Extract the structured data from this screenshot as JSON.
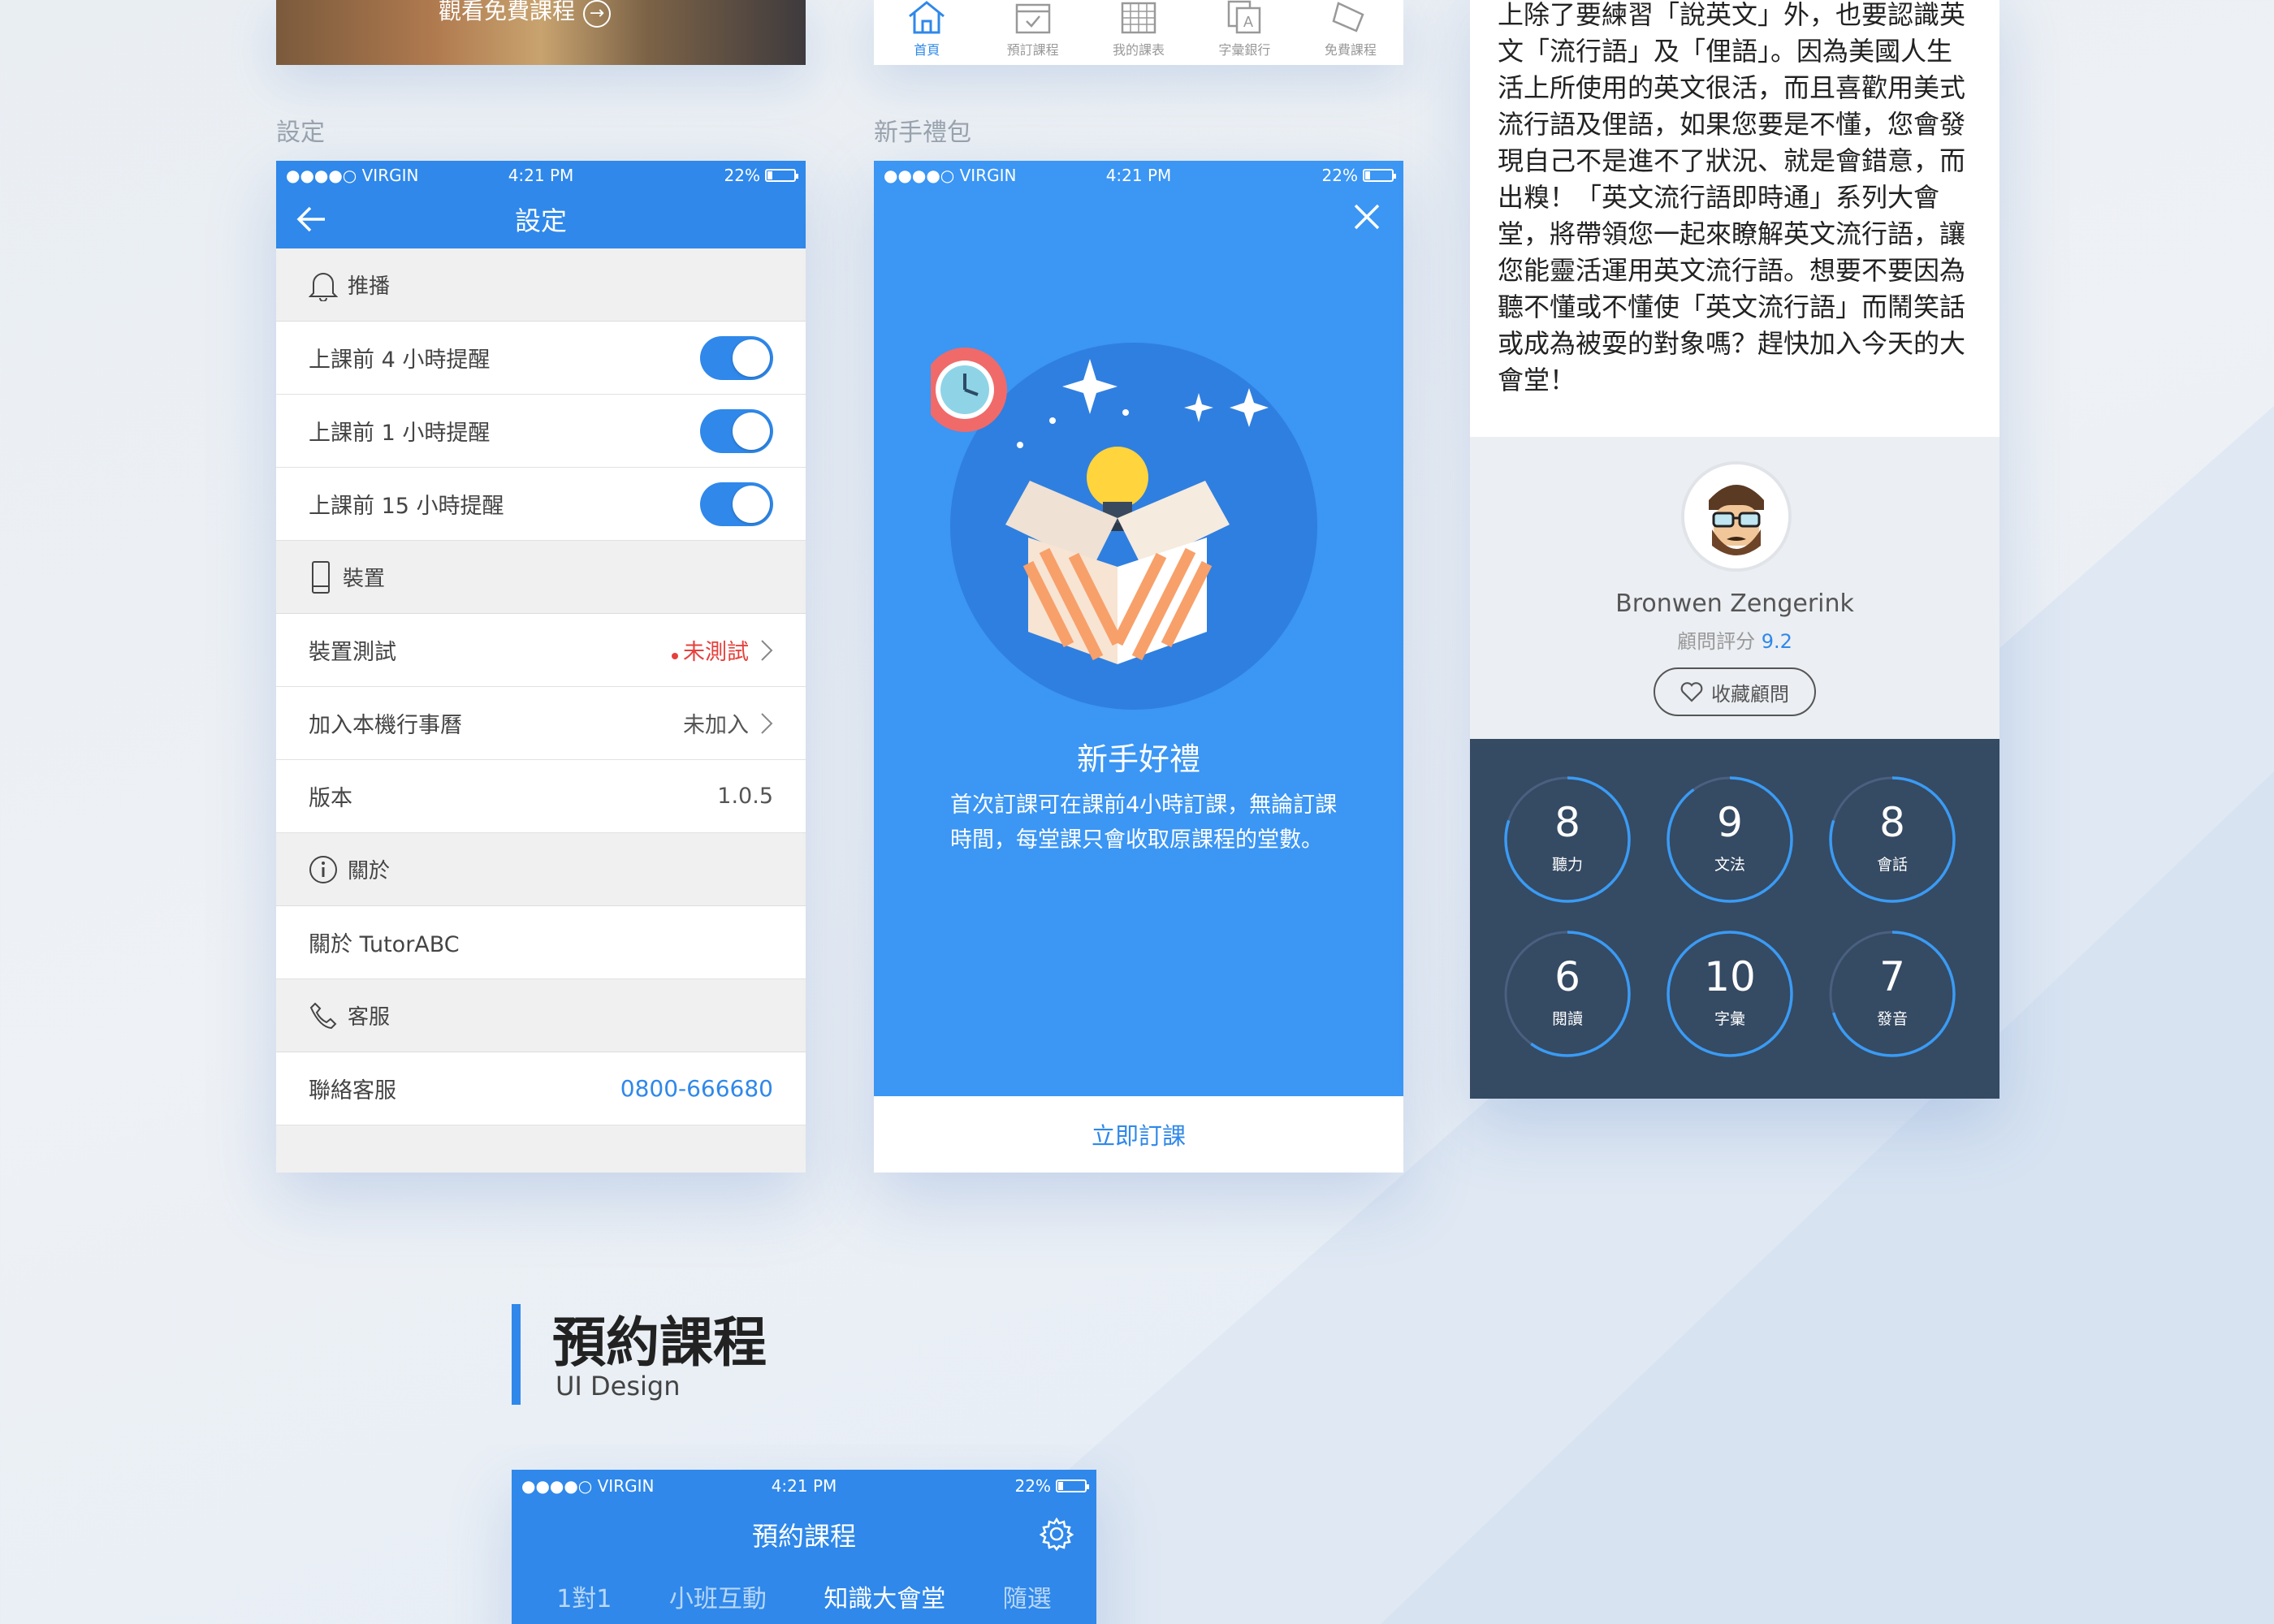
{
  "promo": {
    "text": "觀看免費課程"
  },
  "tabbar": {
    "tabs": [
      {
        "label": "首頁",
        "icon": "home-icon"
      },
      {
        "label": "預訂課程",
        "icon": "calendar-icon"
      },
      {
        "label": "我的課表",
        "icon": "schedule-icon"
      },
      {
        "label": "字彙銀行",
        "icon": "vocab-icon"
      },
      {
        "label": "免費課程",
        "icon": "free-tag-icon"
      }
    ]
  },
  "labels": {
    "settings_section": "設定",
    "gift_section": "新手禮包"
  },
  "statusbar": {
    "carrier": "●●●●○ VIRGIN",
    "time": "4:21 PM",
    "battery": "22%"
  },
  "settings": {
    "title": "設定",
    "push_header": "推播",
    "push_rows": [
      "上課前 4 小時提醒",
      "上課前 1 小時提醒",
      "上課前 15 小時提醒"
    ],
    "device_header": "裝置",
    "device_test_label": "裝置測試",
    "device_test_value": "未測試",
    "calendar_label": "加入本機行事曆",
    "calendar_value": "未加入",
    "version_label": "版本",
    "version_value": "1.0.5",
    "about_header": "關於",
    "about_row": "關於 TutorABC",
    "service_header": "客服",
    "service_label": "聯絡客服",
    "service_phone": "0800-666680"
  },
  "gift": {
    "title": "新手好禮",
    "description": "首次訂課可在課前4小時訂課，無論訂課時間，每堂課只會收取原課程的堂數。",
    "cta": "立即訂課"
  },
  "consultant": {
    "article": "上除了要練習「說英文」外，也要認識英文「流行語」及「俚語」。因為美國人生活上所使用的英文很活，而且喜歡用美式流行語及俚語，如果您要是不懂，您會發現自己不是進不了狀況、就是會錯意，而出糗！「英文流行語即時通」系列大會堂，將帶領您一起來瞭解英文流行語，讓您能靈活運用英文流行語。想要不要因為聽不懂或不懂使「英文流行語」而鬧笑話或成為被耍的對象嗎？趕快加入今天的大會堂！",
    "name": "Bronwen Zengerink",
    "score_label": "顧問評分",
    "score": "9.2",
    "fav_label": "收藏顧問",
    "skills": [
      {
        "score": "8",
        "label": "聽力",
        "fraction": 0.8
      },
      {
        "score": "9",
        "label": "文法",
        "fraction": 0.9
      },
      {
        "score": "8",
        "label": "會話",
        "fraction": 0.8
      },
      {
        "score": "6",
        "label": "閱讀",
        "fraction": 0.6
      },
      {
        "score": "10",
        "label": "字彙",
        "fraction": 1.0
      },
      {
        "score": "7",
        "label": "發音",
        "fraction": 0.7
      }
    ]
  },
  "booking": {
    "section_title": "預約課程",
    "section_sub": "UI Design",
    "title": "預約課程",
    "tabs": [
      "1對1",
      "小班互動",
      "知識大會堂",
      "隨選"
    ],
    "active_tab": "知識大會堂"
  },
  "colors": {
    "accent": "#2f88ea",
    "gift_bg": "#3b96f4",
    "skills_bg": "#354a63",
    "alert": "#e6403c"
  }
}
